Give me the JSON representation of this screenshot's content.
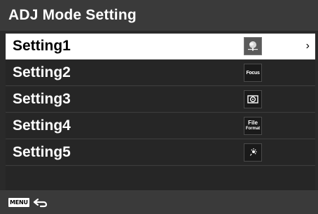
{
  "header": {
    "title": "ADJ Mode Setting"
  },
  "settings": [
    {
      "label": "Setting1",
      "icon": "scene-mode-icon",
      "selected": true
    },
    {
      "label": "Setting2",
      "icon": "focus-icon",
      "icon_text": "Focus"
    },
    {
      "label": "Setting3",
      "icon": "metering-icon"
    },
    {
      "label": "Setting4",
      "icon": "file-format-icon",
      "icon_text_line1": "File",
      "icon_text_line2": "Format"
    },
    {
      "label": "Setting5",
      "icon": "white-balance-icon"
    }
  ],
  "footer": {
    "menu_label": "MENU",
    "back_icon": "back-arrow-icon"
  },
  "colors": {
    "background": "#2a2a2a",
    "title_bar": "#3a3a3a",
    "selected_row": "#ffffff",
    "text": "#ffffff"
  }
}
